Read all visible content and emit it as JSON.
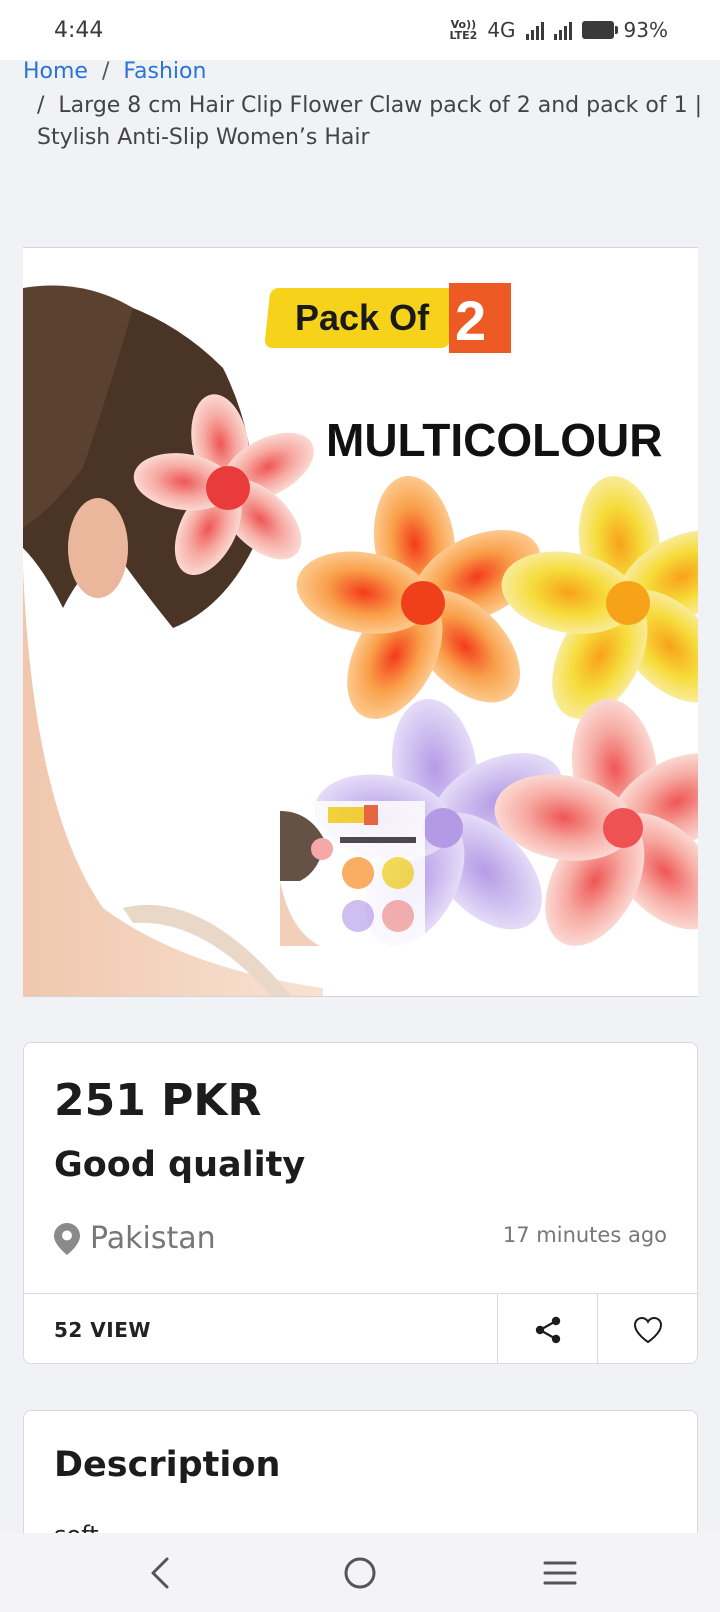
{
  "status_bar": {
    "time": "4:44",
    "volte_line1": "Vo))",
    "volte_line2": "LTE2",
    "network": "4G",
    "battery": "93%"
  },
  "breadcrumb": {
    "home": "Home",
    "separator": "/",
    "category": "Fashion",
    "current": "Large 8 cm Hair Clip Flower Claw pack of 2 and pack of 1 | Stylish Anti-Slip Women’s Hair"
  },
  "product_image": {
    "badge_text": "Pack Of",
    "badge_number": "2",
    "banner_text": "MULTICOLOUR",
    "flower_colors": [
      "#f7932b",
      "#f5d31c",
      "#b9a4ec",
      "#f5a49d",
      "#ef6b6b"
    ]
  },
  "listing": {
    "price": "251 PKR",
    "title": "Good quality",
    "location": "Pakistan",
    "posted": "17 minutes ago",
    "views": "52 VIEW"
  },
  "description": {
    "heading": "Description",
    "text": "soft"
  },
  "colors": {
    "link": "#2a74d6",
    "badge_yellow": "#f6d21b",
    "badge_orange": "#ee5a24"
  }
}
